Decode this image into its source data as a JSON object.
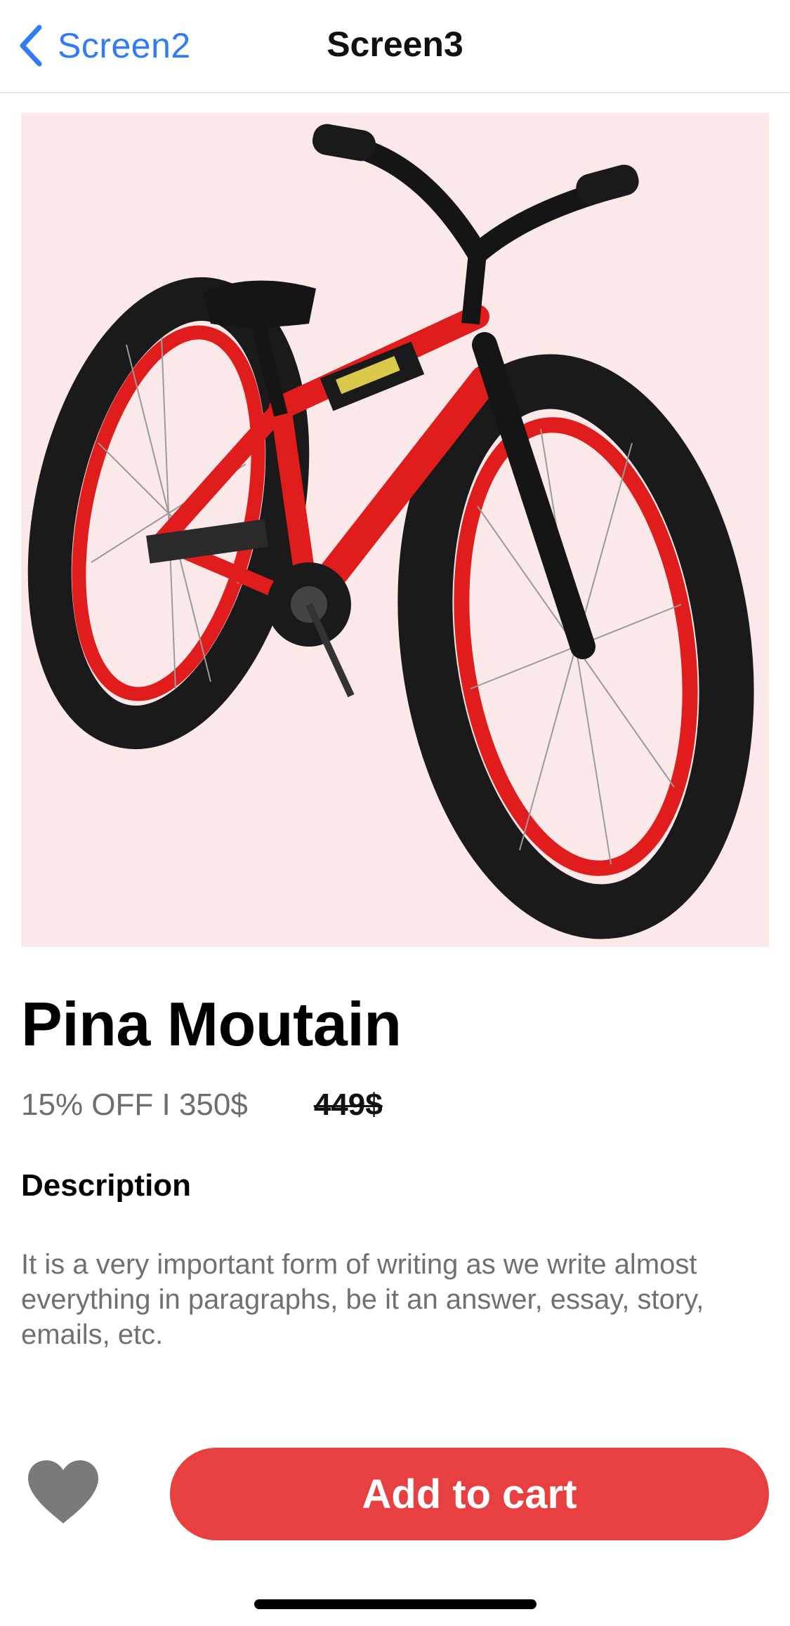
{
  "nav": {
    "back_label": "Screen2",
    "title": "Screen3"
  },
  "product": {
    "image_icon": "bicycle-photo",
    "name": "Pina Moutain",
    "discount_price_text": "15% OFF I 350$",
    "original_price_text": "449$"
  },
  "description": {
    "heading": "Description",
    "text": "It is a very important form of writing as we write almost everything in paragraphs, be it an answer, essay, story, emails, etc."
  },
  "actions": {
    "favorite_icon": "heart-icon",
    "add_to_cart_label": "Add to cart"
  },
  "colors": {
    "accent_blue": "#2f7cf6",
    "cta_red": "#e84040",
    "image_background": "#fbe9ea",
    "heart_gray": "#7a7a7a"
  }
}
